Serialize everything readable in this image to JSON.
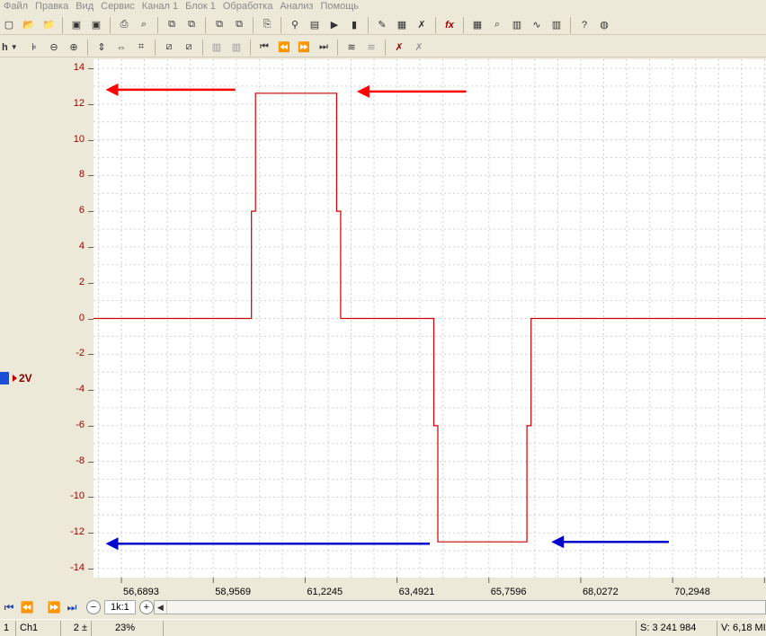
{
  "menu": [
    "Файл",
    "Правка",
    "Вид",
    "Сервис",
    "Канал 1",
    "Блок 1",
    "Обработка",
    "Анализ",
    "Помощь"
  ],
  "toolbar": {
    "icons": [
      "new-icon",
      "open-icon",
      "open-folder-icon",
      "save-icon",
      "save-as-icon",
      "print-icon",
      "print-preview-icon",
      "copy-block-icon",
      "paste-block-icon",
      "copy-screen-icon",
      "paste-screen-icon",
      "copy-icon",
      "probe-icon",
      "record-icon",
      "play-icon",
      "battery-icon",
      "edit-icon",
      "report-icon",
      "delete-icon",
      "fx-icon",
      "table-icon",
      "search-icon",
      "fft-icon",
      "correlation-icon",
      "spectrum-icon",
      "help-icon",
      "web-icon"
    ],
    "fx_label": "fx",
    "channel_select": "h"
  },
  "channel": {
    "name": "Ch1",
    "scale": "2V",
    "color": "#c00000"
  },
  "status": {
    "channel_number": "1",
    "channel_name": "Ch1",
    "gain": "2 ±",
    "percent": "23%",
    "samples": "S: 3 241 984",
    "voltage": "V: 6,18 MI"
  },
  "scale_label": "1k:1",
  "chart_data": {
    "type": "line",
    "title": "",
    "xlabel": "",
    "ylabel": "",
    "xlim": [
      56.0,
      72.6
    ],
    "ylim": [
      -14.5,
      14.5
    ],
    "y_ticks": [
      14,
      12,
      10,
      8,
      6,
      4,
      2,
      0,
      -2,
      -4,
      -6,
      -8,
      -10,
      -12,
      -14
    ],
    "x_ticks": [
      "56,6893",
      "58,9569",
      "61,2245",
      "63,4921",
      "65,7596",
      "68,0272",
      "70,2948",
      "72,5624"
    ],
    "x_tick_values": [
      56.6893,
      58.9569,
      61.2245,
      63.4921,
      65.7596,
      68.0272,
      70.2948,
      72.5624
    ],
    "grid": true,
    "series": [
      {
        "color": "#cc0000",
        "x": [
          56.0,
          59.9,
          59.9,
          60.0,
          60.0,
          60.1,
          60.1,
          62.0,
          62.0,
          62.1,
          62.1,
          64.4,
          64.4,
          64.5,
          64.5,
          66.7,
          66.7,
          66.8,
          66.8,
          72.6
        ],
        "y": [
          0,
          0,
          6,
          6,
          12.6,
          12.6,
          12.6,
          12.6,
          6,
          6,
          0,
          0,
          -6,
          -6,
          -12.5,
          -12.5,
          -6,
          -6,
          0,
          0
        ]
      }
    ],
    "annotations": [
      {
        "type": "arrow",
        "color": "#ff0000",
        "y": 12.8,
        "x_from": 59.5,
        "x_to": 56.3
      },
      {
        "type": "arrow",
        "color": "#ff0000",
        "y": 12.7,
        "x_from": 65.2,
        "x_to": 62.5
      },
      {
        "type": "arrow",
        "color": "#0000cc",
        "y": -12.6,
        "x_from": 64.3,
        "x_to": 56.3
      },
      {
        "type": "arrow",
        "color": "#0000cc",
        "y": -12.5,
        "x_from": 70.2,
        "x_to": 67.3
      }
    ]
  }
}
